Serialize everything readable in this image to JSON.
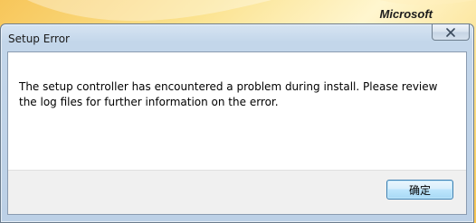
{
  "background": {
    "brand_text": "Microsoft"
  },
  "dialog": {
    "title": "Setup Error",
    "close_icon": "close-icon",
    "message": "The setup controller has encountered a problem during install.  Please review the log files for further information on the error.",
    "ok_label": "确定"
  },
  "colors": {
    "title_bar": "#c3d6ea",
    "button_border": "#3c7fb1",
    "footer": "#f0f0f0"
  }
}
